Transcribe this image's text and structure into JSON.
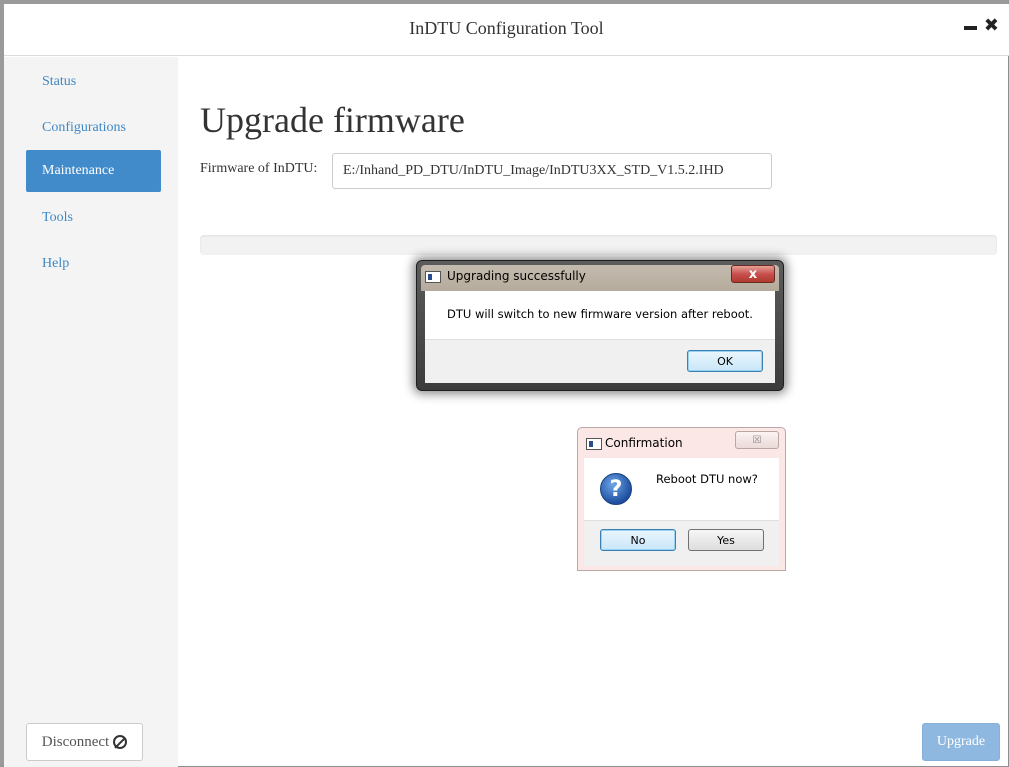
{
  "window": {
    "title": "InDTU Configuration Tool",
    "minimize_icon": "minimize-icon",
    "close_glyph": "✖"
  },
  "sidebar": {
    "items": [
      {
        "label": "Status",
        "active": false
      },
      {
        "label": "Configurations",
        "active": false
      },
      {
        "label": "Maintenance",
        "active": true
      },
      {
        "label": "Tools",
        "active": false
      },
      {
        "label": "Help",
        "active": false
      }
    ],
    "disconnect_label": "Disconnect"
  },
  "main": {
    "page_title": "Upgrade firmware",
    "firmware_label": "Firmware of InDTU:",
    "firmware_path": "E:/Inhand_PD_DTU/InDTU_Image/InDTU3XX_STD_V1.5.2.IHD",
    "progress_fraction": 0,
    "upgrade_label": "Upgrade"
  },
  "dialog_upgrade": {
    "title": "Upgrading successfully",
    "message": "DTU will switch to new firmware version after reboot.",
    "ok_label": "OK",
    "close_glyph": "x"
  },
  "dialog_confirm": {
    "title": "Confirmation",
    "message": "Reboot DTU now?",
    "no_label": "No",
    "yes_label": "Yes",
    "close_glyph": "☒",
    "icon_glyph": "?"
  },
  "colors": {
    "accent": "#428bca",
    "nav_text": "#3f88c5",
    "upgrade_button_disabled": "#8fb8e0"
  }
}
